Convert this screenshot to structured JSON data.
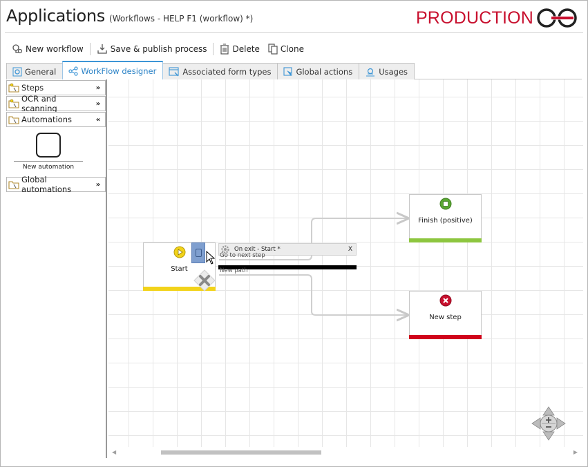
{
  "header": {
    "title": "Applications",
    "subtitle": "(Workflows - HELP F1 (workflow) *)",
    "environment_label": "PRODUCTION",
    "environment_color": "#c8102e"
  },
  "toolbar": {
    "new_workflow": "New workflow",
    "save_publish": "Save & publish process",
    "delete": "Delete",
    "clone": "Clone"
  },
  "tabs": [
    {
      "label": "General",
      "icon": "gear-icon",
      "active": false
    },
    {
      "label": "WorkFlow designer",
      "icon": "share-icon",
      "active": true
    },
    {
      "label": "Associated form types",
      "icon": "form-icon",
      "active": false
    },
    {
      "label": "Global actions",
      "icon": "action-icon",
      "active": false
    },
    {
      "label": "Usages",
      "icon": "usages-icon",
      "active": false
    }
  ],
  "sidebar": {
    "sections": [
      {
        "label": "Steps",
        "expanded": false
      },
      {
        "label": "OCR and scanning",
        "expanded": false
      },
      {
        "label": "Automations",
        "expanded": true
      },
      {
        "label": "Global automations",
        "expanded": false
      }
    ],
    "automation_tool": "New automation"
  },
  "canvas": {
    "nodes": {
      "start": {
        "label": "Start",
        "color": "#f2d31a"
      },
      "finish": {
        "label": "Finish (positive)",
        "color": "#8dc63f"
      },
      "new_step": {
        "label": "New step",
        "color": "#d0021b"
      }
    },
    "exit_panel": {
      "title": "On exit - Start *",
      "close": "X",
      "path_label": "Go to next step",
      "new_path": "New path"
    }
  },
  "colors": {
    "accent": "#3c95d6",
    "start_icon": "#f2d31a",
    "finish_icon": "#5aa832",
    "error_icon": "#c8102e"
  }
}
